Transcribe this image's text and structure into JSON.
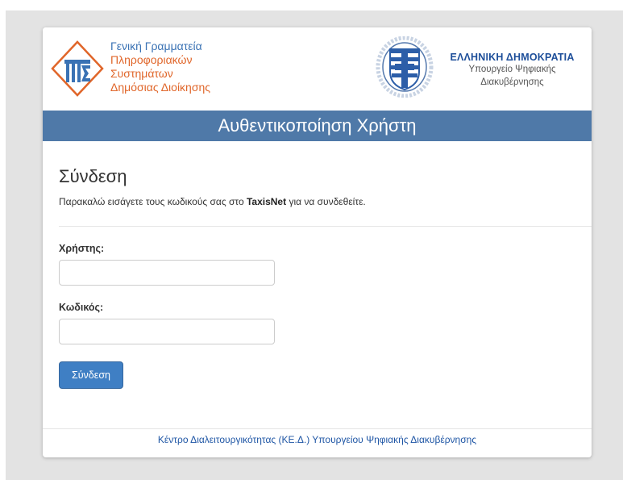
{
  "org": {
    "line1": "Γενική Γραμματεία",
    "line2": "Πληροφοριακών",
    "line3": "Συστημάτων",
    "line4": "Δημόσιας Διοίκησης"
  },
  "ministry": {
    "title": "ΕΛΛΗΝΙΚΗ ΔΗΜΟΚΡΑΤΙΑ",
    "line1": "Υπουργείο Ψηφιακής",
    "line2": "Διακυβέρνησης"
  },
  "banner": {
    "title": "Αυθεντικοποίηση Χρήστη"
  },
  "login": {
    "heading": "Σύνδεση",
    "intro_before": "Παρακαλώ εισάγετε τους κωδικούς σας στο ",
    "intro_brand": "TaxisNet",
    "intro_after": " για να συνδεθείτε.",
    "username_label": "Χρήστης:",
    "username_value": "",
    "password_label": "Κωδικός:",
    "password_value": "",
    "submit_label": "Σύνδεση"
  },
  "footer": {
    "text": "Κέντρο Διαλειτουργικότητας (ΚΕ.Δ.) Υπουργείου Ψηφιακής Διακυβέρνησης"
  },
  "colors": {
    "banner": "#4f79a8",
    "button": "#3f7fc4",
    "link": "#1f56a5",
    "logo_orange": "#e0662a",
    "logo_blue": "#3a72b4"
  }
}
